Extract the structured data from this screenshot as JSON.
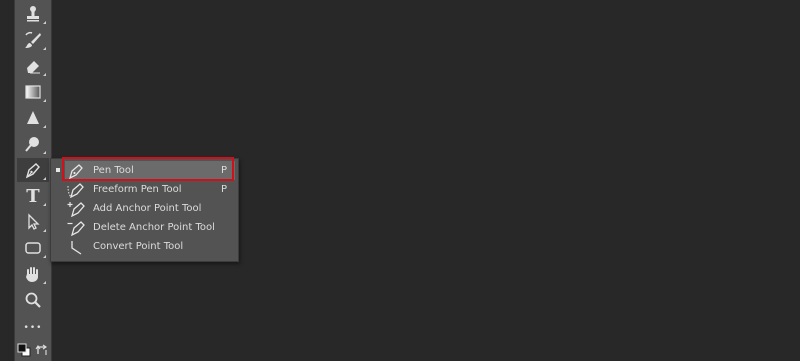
{
  "toolbar": {
    "tools": [
      {
        "name": "stamp-icon"
      },
      {
        "name": "history-brush-icon"
      },
      {
        "name": "eraser-icon"
      },
      {
        "name": "gradient-icon"
      },
      {
        "name": "blur-icon"
      },
      {
        "name": "dodge-icon"
      },
      {
        "name": "pen-icon",
        "active": true
      },
      {
        "name": "type-icon",
        "glyph": "T"
      },
      {
        "name": "path-selection-icon"
      },
      {
        "name": "rectangle-icon"
      },
      {
        "name": "hand-icon"
      },
      {
        "name": "zoom-icon"
      },
      {
        "name": "more-icon",
        "glyph": "•••"
      },
      {
        "name": "default-colors-icon"
      },
      {
        "name": "swap-colors-icon"
      }
    ]
  },
  "flyout": {
    "items": [
      {
        "label": "Pen Tool",
        "shortcut": "P",
        "icon": "pen-icon",
        "selected": true
      },
      {
        "label": "Freeform Pen Tool",
        "shortcut": "P",
        "icon": "freeform-pen-icon"
      },
      {
        "label": "Add Anchor Point Tool",
        "shortcut": "",
        "icon": "add-anchor-point-icon"
      },
      {
        "label": "Delete Anchor Point Tool",
        "shortcut": "",
        "icon": "delete-anchor-point-icon"
      },
      {
        "label": "Convert Point Tool",
        "shortcut": "",
        "icon": "convert-point-icon"
      }
    ]
  },
  "colors": {
    "workspace": "#282828",
    "panel": "#535353",
    "highlight": "#d0101a"
  }
}
